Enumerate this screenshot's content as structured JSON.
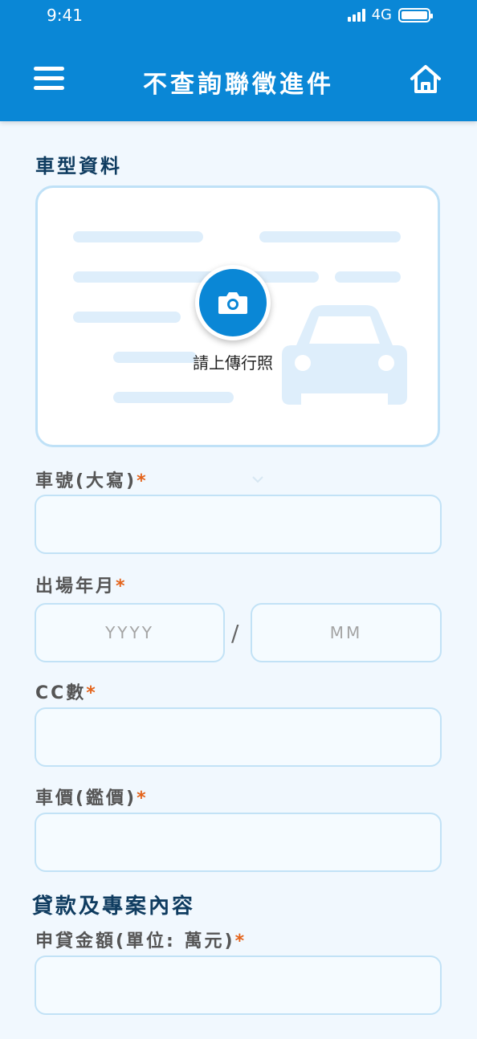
{
  "status": {
    "time": "9:41",
    "network": "4G"
  },
  "header": {
    "title": "不查詢聯徵進件",
    "menu_icon": "hamburger-icon",
    "home_icon": "home-icon"
  },
  "vehicle_section": {
    "title": "車型資料",
    "upload": {
      "label": "請上傳行照",
      "icon": "camera-icon"
    }
  },
  "fields": {
    "plate": {
      "label": "車號(大寫)",
      "required": "*",
      "value": "",
      "placeholder": ""
    },
    "manufacture": {
      "label": "出場年月",
      "required": "*",
      "year_placeholder": "YYYY",
      "month_placeholder": "MM",
      "separator": "/"
    },
    "cc": {
      "label": "CC數",
      "required": "*",
      "value": "",
      "placeholder": ""
    },
    "price": {
      "label": "車價(鑑價)",
      "required": "*",
      "value": "",
      "placeholder": ""
    }
  },
  "loan_section": {
    "title": "貸款及專案內容",
    "amount": {
      "label": "申貸金額(單位: 萬元)",
      "required": "*",
      "value": "",
      "placeholder": ""
    }
  },
  "colors": {
    "primary": "#0a87d6",
    "required": "#e4631a",
    "background": "#f1f8fe",
    "input_border": "#c2e2f6"
  }
}
